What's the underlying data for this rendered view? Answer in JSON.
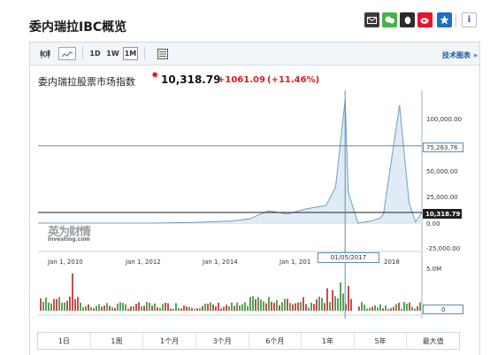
{
  "page": {
    "title": "委内瑞拉IBC概览"
  },
  "toolbar": {
    "period_buttons": [
      "1D",
      "1W",
      "1M"
    ],
    "selected_period": "1M",
    "tech_chart_link": "技术图表 »"
  },
  "chart": {
    "index_name": "委内瑞拉股票市场指数",
    "value": "10,318.79",
    "change": "+1061.09",
    "change_pct": "(+11.46%)",
    "watermark_cn": "英为财情",
    "watermark_en": "Investing.com",
    "y_ticks": [
      "100,000.00",
      "50,000.00",
      "25,000.00",
      "0.00",
      "-25,000.00",
      "5.0M"
    ],
    "crosshair_y_value": "75,263.76",
    "current_value_tag": "10,318.79",
    "volume_zero": "0",
    "x_ticks": [
      "Jan 1, 2010",
      "Jan 1, 2012",
      "Jan 1, 2014",
      "Jan 1, 201",
      "2018"
    ],
    "crosshair_date": "01/05/2017",
    "colors": {
      "line": "#6a9fc7",
      "area": "#dbe8f3",
      "up": "#5aa05a",
      "down": "#c0504d",
      "accent": "#d11f1f"
    }
  },
  "chart_data": {
    "type": "area",
    "x": [
      "2009-01",
      "2010-01",
      "2011-01",
      "2012-01",
      "2013-01",
      "2014-01",
      "2014-07",
      "2015-01",
      "2015-07",
      "2016-01",
      "2016-07",
      "2016-10",
      "2017-01",
      "2017-02",
      "2017-05",
      "2017-07",
      "2017-09",
      "2017-12",
      "2018-01",
      "2018-06",
      "2018-09",
      "2018-11",
      "2019-01"
    ],
    "values": [
      0,
      0,
      0,
      0,
      500,
      2000,
      4000,
      12000,
      9000,
      14000,
      17000,
      35000,
      120000,
      30000,
      0,
      1000,
      2000,
      5000,
      9000,
      115000,
      20000,
      1000,
      10318.79
    ],
    "ylim": [
      -25000,
      120000
    ],
    "crosshair": {
      "date": "01/05/2017",
      "y": 75263.76
    },
    "last_value": 10318.79,
    "volume_ylim": [
      0,
      5000000
    ]
  },
  "periods": [
    "1日",
    "1周",
    "1个月",
    "3个月",
    "6个月",
    "1年",
    "5年",
    "最大值"
  ]
}
